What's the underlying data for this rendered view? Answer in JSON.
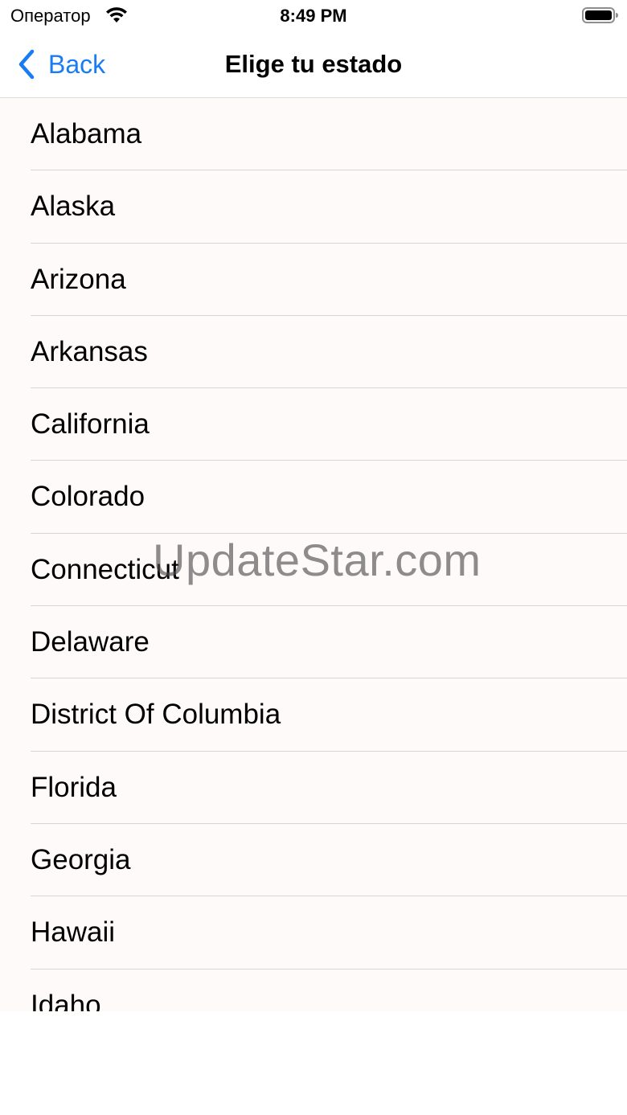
{
  "status_bar": {
    "carrier": "Оператор",
    "time": "8:49 PM",
    "wifi_icon": "wifi-icon",
    "battery_icon": "battery-full-icon"
  },
  "nav": {
    "back_label": "Back",
    "back_icon": "chevron-left-icon",
    "title": "Elige tu estado"
  },
  "states": [
    {
      "label": "Alabama"
    },
    {
      "label": "Alaska"
    },
    {
      "label": "Arizona"
    },
    {
      "label": "Arkansas"
    },
    {
      "label": "California"
    },
    {
      "label": "Colorado"
    },
    {
      "label": "Connecticut"
    },
    {
      "label": "Delaware"
    },
    {
      "label": "District Of Columbia"
    },
    {
      "label": "Florida"
    },
    {
      "label": "Georgia"
    },
    {
      "label": "Hawaii"
    },
    {
      "label": "Idaho"
    }
  ],
  "watermark": "UpdateStar.com",
  "colors": {
    "accent": "#1a7cf5",
    "list_background": "#fefaf9",
    "divider": "#d8d6d5"
  }
}
